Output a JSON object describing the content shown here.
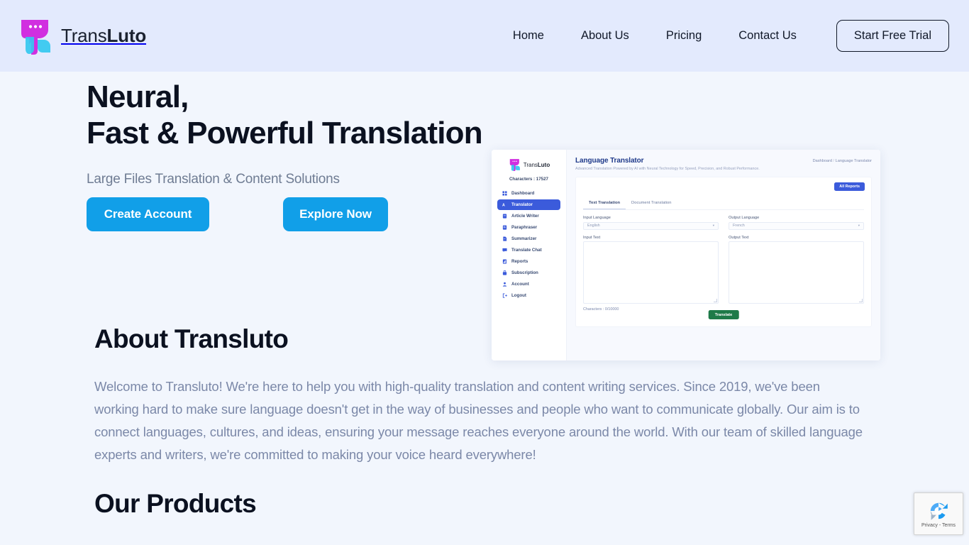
{
  "brand": {
    "name_thin": "Trans",
    "name_bold": "Luto",
    "logo_icon": "transluto-logo-icon"
  },
  "header": {
    "nav": [
      {
        "label": "Home"
      },
      {
        "label": "About Us"
      },
      {
        "label": "Pricing"
      },
      {
        "label": "Contact Us"
      }
    ],
    "cta_label": "Start Free Trial"
  },
  "hero": {
    "title": "Neural,\nFast & Powerful Translation",
    "subtitle": "Large Files Translation & Content Solutions",
    "primary_button": "Create Account",
    "secondary_button": "Explore Now"
  },
  "mockup": {
    "brand_thin": "Trans",
    "brand_bold": "Luto",
    "characters_label": "Characters : 17527",
    "sidebar_items": [
      {
        "label": "Dashboard",
        "icon": "grid-icon",
        "active": false
      },
      {
        "label": "Translator",
        "icon": "translate-icon",
        "active": true
      },
      {
        "label": "Article Writer",
        "icon": "article-icon",
        "active": false
      },
      {
        "label": "Paraphraser",
        "icon": "paraphrase-icon",
        "active": false
      },
      {
        "label": "Summarizer",
        "icon": "summarize-icon",
        "active": false
      },
      {
        "label": "Translate Chat",
        "icon": "chat-icon",
        "active": false
      },
      {
        "label": "Reports",
        "icon": "reports-icon",
        "active": false
      },
      {
        "label": "Subscription",
        "icon": "subscription-icon",
        "active": false
      },
      {
        "label": "Account",
        "icon": "user-icon",
        "active": false
      },
      {
        "label": "Logout",
        "icon": "logout-icon",
        "active": false
      }
    ],
    "page_title": "Language Translator",
    "page_subtitle": "Advanced Translation Powered by AI with Neural Technology for Speed, Precision, and Robust Performance.",
    "breadcrumb_root": "Dashboard",
    "breadcrumb_sep": "/",
    "breadcrumb_current": "Language Translator",
    "all_reports_label": "All Reports",
    "tabs": [
      {
        "label": "Text Translation",
        "active": true
      },
      {
        "label": "Document Translation",
        "active": false
      }
    ],
    "input_language_label": "Input Language",
    "input_language_value": "English",
    "output_language_label": "Output Language",
    "output_language_value": "French",
    "input_text_label": "Input Text",
    "output_text_label": "Output Text",
    "character_count": "Characters : 0/10000",
    "translate_label": "Translate",
    "caret_glyph": "▾"
  },
  "about": {
    "title": "About Transluto",
    "body": "Welcome to Transluto! We're here to help you with high-quality translation and content writing services. Since 2019, we've been working hard to make sure language doesn't get in the way of businesses and people who want to communicate globally. Our aim is to connect languages, cultures, and ideas, ensuring your message reaches everyone around the world. With our team of skilled language experts and writers, we're committed to making your voice heard everywhere!"
  },
  "products": {
    "title": "Our Products"
  },
  "recaptcha": {
    "links": "Privacy - Terms",
    "icon": "recaptcha-icon"
  },
  "colors": {
    "header_bg": "#e3eafd",
    "page_bg": "#f2f6fd",
    "accent_blue": "#119fe8",
    "mockup_active_blue": "#3b5bdb",
    "translate_green": "#1e7a48",
    "logo_magenta": "#d12fe0",
    "logo_cyan": "#34c8f0",
    "body_text": "#7b88a8",
    "heading_text": "#0b1120"
  }
}
